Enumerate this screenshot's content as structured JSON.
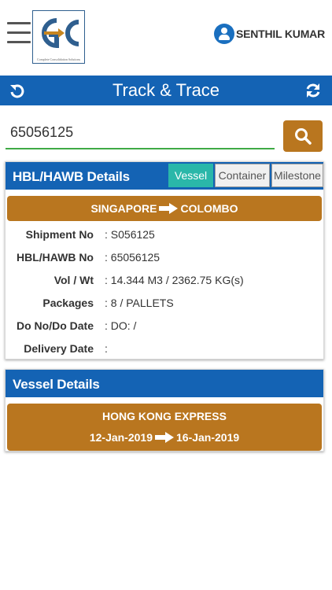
{
  "header": {
    "logo_text": "GC",
    "logo_tagline": "Complete Consolidation Solutions",
    "user_name": "SENTHIL KUMAR"
  },
  "titlebar": {
    "title": "Track & Trace"
  },
  "search": {
    "value": "65056125",
    "placeholder": ""
  },
  "hbl_card": {
    "title": "HBL/HAWB Details",
    "tabs": [
      {
        "label": "Vessel",
        "active": true
      },
      {
        "label": "Container",
        "active": false
      },
      {
        "label": "Milestone",
        "active": false
      }
    ],
    "origin": "SINGAPORE",
    "destination": "COLOMBO",
    "fields": [
      {
        "label": "Shipment No",
        "value": ": S056125"
      },
      {
        "label": "HBL/HAWB No",
        "value": ": 65056125"
      },
      {
        "label": "Vol / Wt",
        "value": ": 14.344 M3 / 2362.75 KG(s)"
      },
      {
        "label": "Packages",
        "value": ": 8 / PALLETS"
      },
      {
        "label": "Do No/Do Date",
        "value": ": DO: /"
      },
      {
        "label": "Delivery Date",
        "value": ":"
      }
    ]
  },
  "vessel_card": {
    "title": "Vessel Details",
    "vessel_name": "HONG KONG EXPRESS",
    "departure_date": "12-Jan-2019",
    "arrival_date": "16-Jan-2019"
  },
  "colors": {
    "primary_blue": "#1463b4",
    "accent_gold": "#b9761f",
    "active_tab": "#2ab7a9",
    "input_underline": "#3faa45"
  }
}
